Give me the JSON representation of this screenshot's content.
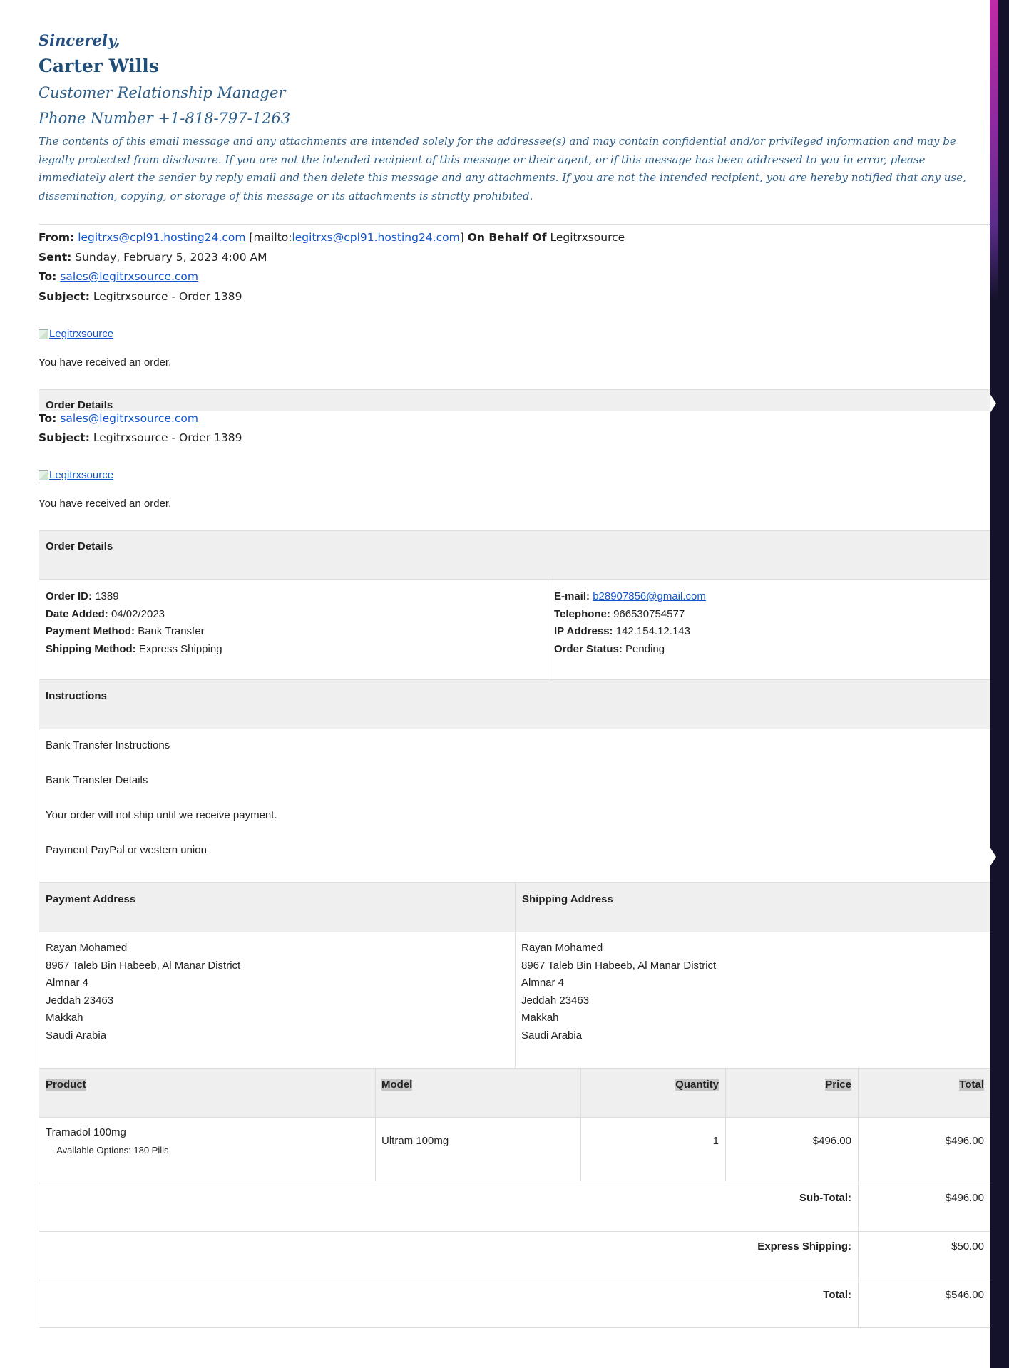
{
  "signature": {
    "closing": "Sincerely,",
    "name": "Carter Wills",
    "role": "Customer Relationship Manager",
    "phone": "Phone Number +1-818-797-1263",
    "disclaimer": "The contents of this email message and any attachments are intended solely for the addressee(s) and may contain confidential and/or privileged information and may be legally protected from disclosure. If you are not the intended recipient of this message or their agent, or if this message has been addressed to you in error, please immediately alert the sender by reply email and then delete this message and any attachments. If you are not the intended recipient, you are hereby notified that any use, dissemination, copying, or storage of this message or its attachments is strictly prohibited."
  },
  "email": {
    "from_label": "From:",
    "from_address": "legitrxs@cpl91.hosting24.com",
    "mailto_open": "[mailto:",
    "mailto_address": "legitrxs@cpl91.hosting24.com",
    "mailto_close": "]",
    "behalf_label": "On Behalf Of",
    "behalf_name": "Legitrxsource",
    "sent_label": "Sent:",
    "sent_value": "Sunday, February 5, 2023 4:00 AM",
    "to_label": "To:",
    "to_address": "sales@legitrxsource.com",
    "subject_label": "Subject:",
    "subject_value": "Legitrxsource - Order 1389",
    "logo_alt": "Legitrxsource",
    "received_text": "You have received an order."
  },
  "order": {
    "details_title": "Order Details",
    "order_id_label": "Order ID:",
    "order_id": "1389",
    "date_label": "Date Added:",
    "date": "04/02/2023",
    "payment_method_label": "Payment Method:",
    "payment_method": "Bank Transfer",
    "shipping_method_label": "Shipping Method:",
    "shipping_method": "Express Shipping",
    "email_label": "E-mail:",
    "email": "b28907856@gmail.com",
    "telephone_label": "Telephone:",
    "telephone": "966530754577",
    "ip_label": "IP Address:",
    "ip": "142.154.12.143",
    "status_label": "Order Status:",
    "status": "Pending"
  },
  "instructions": {
    "title": "Instructions",
    "lines": [
      "Bank Transfer Instructions",
      "Bank Transfer Details",
      "Your order will not ship until we receive payment.",
      "Payment PayPal or western union"
    ]
  },
  "addresses": {
    "payment_title": "Payment Address",
    "shipping_title": "Shipping Address",
    "payment": [
      "Rayan Mohamed",
      "8967 Taleb Bin Habeeb, Al Manar District",
      "Almnar 4",
      "Jeddah 23463",
      "Makkah",
      "Saudi Arabia"
    ],
    "shipping": [
      "Rayan Mohamed",
      "8967 Taleb Bin Habeeb, Al Manar District",
      "Almnar 4",
      "Jeddah 23463",
      "Makkah",
      "Saudi Arabia"
    ]
  },
  "products": {
    "headers": [
      "Product",
      "Model",
      "Quantity",
      "Price",
      "Total"
    ],
    "rows": [
      {
        "product": "Tramadol 100mg",
        "option": "- Available Options: 180 Pills",
        "model": "Ultram 100mg",
        "quantity": "1",
        "price": "$496.00",
        "total": "$496.00"
      }
    ],
    "totals": [
      {
        "label": "Sub-Total:",
        "value": "$496.00"
      },
      {
        "label": "Express Shipping:",
        "value": "$50.00"
      },
      {
        "label": "Total:",
        "value": "$546.00"
      }
    ]
  }
}
